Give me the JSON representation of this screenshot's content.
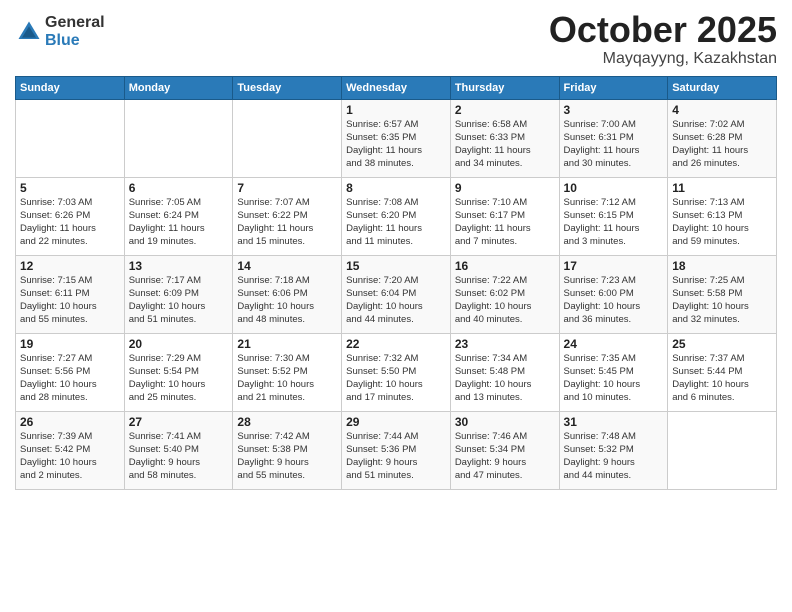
{
  "header": {
    "logo_general": "General",
    "logo_blue": "Blue",
    "month_title": "October 2025",
    "location": "Mayqayyng, Kazakhstan"
  },
  "weekdays": [
    "Sunday",
    "Monday",
    "Tuesday",
    "Wednesday",
    "Thursday",
    "Friday",
    "Saturday"
  ],
  "weeks": [
    [
      {
        "day": "",
        "info": ""
      },
      {
        "day": "",
        "info": ""
      },
      {
        "day": "",
        "info": ""
      },
      {
        "day": "1",
        "info": "Sunrise: 6:57 AM\nSunset: 6:35 PM\nDaylight: 11 hours\nand 38 minutes."
      },
      {
        "day": "2",
        "info": "Sunrise: 6:58 AM\nSunset: 6:33 PM\nDaylight: 11 hours\nand 34 minutes."
      },
      {
        "day": "3",
        "info": "Sunrise: 7:00 AM\nSunset: 6:31 PM\nDaylight: 11 hours\nand 30 minutes."
      },
      {
        "day": "4",
        "info": "Sunrise: 7:02 AM\nSunset: 6:28 PM\nDaylight: 11 hours\nand 26 minutes."
      }
    ],
    [
      {
        "day": "5",
        "info": "Sunrise: 7:03 AM\nSunset: 6:26 PM\nDaylight: 11 hours\nand 22 minutes."
      },
      {
        "day": "6",
        "info": "Sunrise: 7:05 AM\nSunset: 6:24 PM\nDaylight: 11 hours\nand 19 minutes."
      },
      {
        "day": "7",
        "info": "Sunrise: 7:07 AM\nSunset: 6:22 PM\nDaylight: 11 hours\nand 15 minutes."
      },
      {
        "day": "8",
        "info": "Sunrise: 7:08 AM\nSunset: 6:20 PM\nDaylight: 11 hours\nand 11 minutes."
      },
      {
        "day": "9",
        "info": "Sunrise: 7:10 AM\nSunset: 6:17 PM\nDaylight: 11 hours\nand 7 minutes."
      },
      {
        "day": "10",
        "info": "Sunrise: 7:12 AM\nSunset: 6:15 PM\nDaylight: 11 hours\nand 3 minutes."
      },
      {
        "day": "11",
        "info": "Sunrise: 7:13 AM\nSunset: 6:13 PM\nDaylight: 10 hours\nand 59 minutes."
      }
    ],
    [
      {
        "day": "12",
        "info": "Sunrise: 7:15 AM\nSunset: 6:11 PM\nDaylight: 10 hours\nand 55 minutes."
      },
      {
        "day": "13",
        "info": "Sunrise: 7:17 AM\nSunset: 6:09 PM\nDaylight: 10 hours\nand 51 minutes."
      },
      {
        "day": "14",
        "info": "Sunrise: 7:18 AM\nSunset: 6:06 PM\nDaylight: 10 hours\nand 48 minutes."
      },
      {
        "day": "15",
        "info": "Sunrise: 7:20 AM\nSunset: 6:04 PM\nDaylight: 10 hours\nand 44 minutes."
      },
      {
        "day": "16",
        "info": "Sunrise: 7:22 AM\nSunset: 6:02 PM\nDaylight: 10 hours\nand 40 minutes."
      },
      {
        "day": "17",
        "info": "Sunrise: 7:23 AM\nSunset: 6:00 PM\nDaylight: 10 hours\nand 36 minutes."
      },
      {
        "day": "18",
        "info": "Sunrise: 7:25 AM\nSunset: 5:58 PM\nDaylight: 10 hours\nand 32 minutes."
      }
    ],
    [
      {
        "day": "19",
        "info": "Sunrise: 7:27 AM\nSunset: 5:56 PM\nDaylight: 10 hours\nand 28 minutes."
      },
      {
        "day": "20",
        "info": "Sunrise: 7:29 AM\nSunset: 5:54 PM\nDaylight: 10 hours\nand 25 minutes."
      },
      {
        "day": "21",
        "info": "Sunrise: 7:30 AM\nSunset: 5:52 PM\nDaylight: 10 hours\nand 21 minutes."
      },
      {
        "day": "22",
        "info": "Sunrise: 7:32 AM\nSunset: 5:50 PM\nDaylight: 10 hours\nand 17 minutes."
      },
      {
        "day": "23",
        "info": "Sunrise: 7:34 AM\nSunset: 5:48 PM\nDaylight: 10 hours\nand 13 minutes."
      },
      {
        "day": "24",
        "info": "Sunrise: 7:35 AM\nSunset: 5:45 PM\nDaylight: 10 hours\nand 10 minutes."
      },
      {
        "day": "25",
        "info": "Sunrise: 7:37 AM\nSunset: 5:44 PM\nDaylight: 10 hours\nand 6 minutes."
      }
    ],
    [
      {
        "day": "26",
        "info": "Sunrise: 7:39 AM\nSunset: 5:42 PM\nDaylight: 10 hours\nand 2 minutes."
      },
      {
        "day": "27",
        "info": "Sunrise: 7:41 AM\nSunset: 5:40 PM\nDaylight: 9 hours\nand 58 minutes."
      },
      {
        "day": "28",
        "info": "Sunrise: 7:42 AM\nSunset: 5:38 PM\nDaylight: 9 hours\nand 55 minutes."
      },
      {
        "day": "29",
        "info": "Sunrise: 7:44 AM\nSunset: 5:36 PM\nDaylight: 9 hours\nand 51 minutes."
      },
      {
        "day": "30",
        "info": "Sunrise: 7:46 AM\nSunset: 5:34 PM\nDaylight: 9 hours\nand 47 minutes."
      },
      {
        "day": "31",
        "info": "Sunrise: 7:48 AM\nSunset: 5:32 PM\nDaylight: 9 hours\nand 44 minutes."
      },
      {
        "day": "",
        "info": ""
      }
    ]
  ]
}
